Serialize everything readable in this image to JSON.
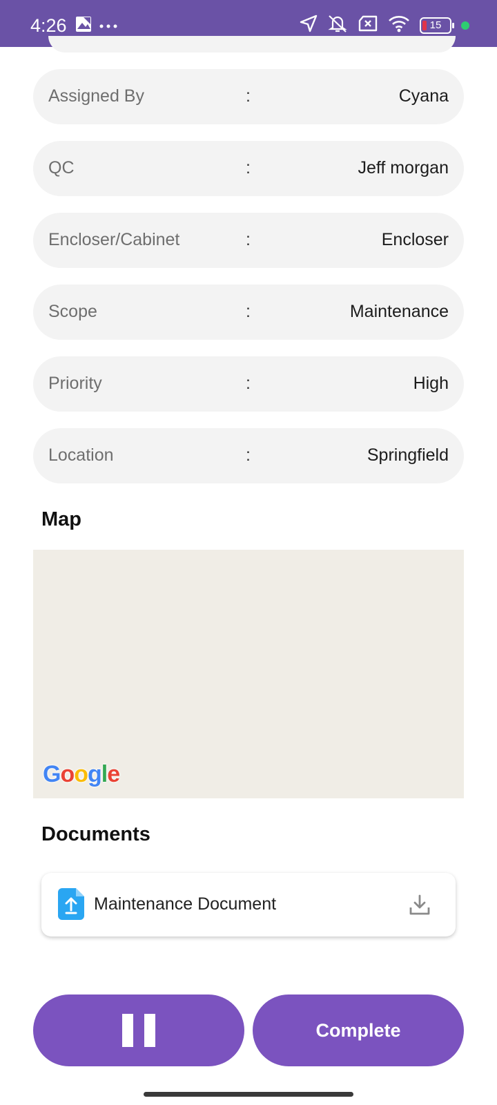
{
  "status_bar": {
    "time": "4:26",
    "battery_level": "15",
    "icons": [
      "gallery-icon",
      "more-icon",
      "location-arrow-icon",
      "bell-muted-icon",
      "sim-x-icon",
      "wifi-icon",
      "battery-icon",
      "green-dot"
    ]
  },
  "details": [
    {
      "label": "Assigned By",
      "sep": ":",
      "value": "Cyana"
    },
    {
      "label": "QC",
      "sep": ":",
      "value": "Jeff morgan"
    },
    {
      "label": "Encloser/Cabinet",
      "sep": ":",
      "value": "Encloser"
    },
    {
      "label": "Scope",
      "sep": ":",
      "value": "Maintenance"
    },
    {
      "label": "Priority",
      "sep": ":",
      "value": "High"
    },
    {
      "label": "Location",
      "sep": ":",
      "value": "Springfield"
    }
  ],
  "map_section": {
    "title": "Map",
    "watermark": "Google"
  },
  "documents_section": {
    "title": "Documents",
    "items": [
      {
        "name": "Maintenance Document",
        "icon": "file-upload-icon",
        "action_icon": "download-icon"
      }
    ]
  },
  "actions": {
    "pause_icon": "pause-icon",
    "complete_label": "Complete"
  },
  "colors": {
    "status_bar": "#6a52a6",
    "primary_button": "#7b53bf",
    "row_bg": "#f3f3f3",
    "map_bg": "#f0ede6"
  }
}
